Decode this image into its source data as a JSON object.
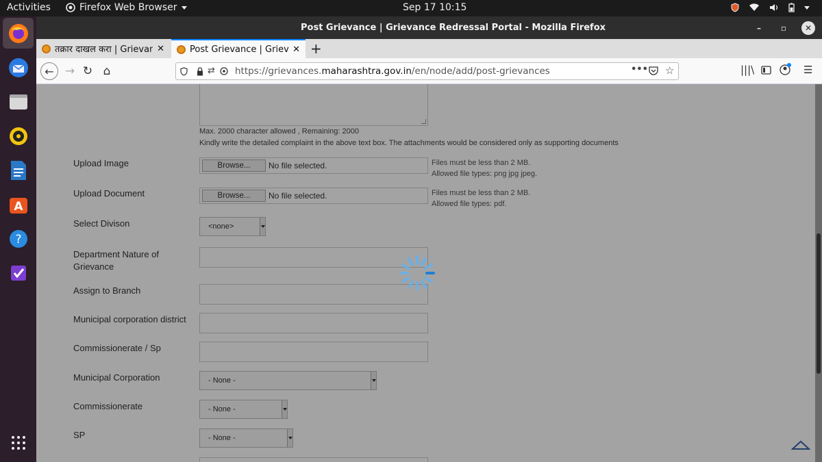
{
  "topbar": {
    "activities": "Activities",
    "app_name": "Firefox Web Browser",
    "clock": "Sep 17  10:15"
  },
  "dock": {
    "items": [
      "firefox-icon",
      "thunderbird-icon",
      "files-icon",
      "rhythmbox-icon",
      "writer-icon",
      "software-icon",
      "help-icon",
      "tasks-icon",
      "show-apps-icon"
    ]
  },
  "window": {
    "title": "Post Grievance | Grievance Redressal Portal - Mozilla Firefox"
  },
  "tabs": [
    {
      "label": "तक्रार दाखल करा | Grievance"
    },
    {
      "label": "Post Grievance | Grievance"
    }
  ],
  "url": {
    "prefix": "https://grievances.",
    "domain": "maharashtra.gov.in",
    "path": "/en/node/add/post-grievances"
  },
  "form": {
    "remaining_note": "Max. 2000 character allowed , Remaining: 2000",
    "detail_note": "Kindly write the detailed complaint in the above text box. The attachments would be considered only as supporting documents",
    "upload_image": {
      "label": "Upload Image",
      "browse": "Browse...",
      "status": "No file selected.",
      "help1": "Files must be less than 2 MB.",
      "help2": "Allowed file types: png jpg jpeg."
    },
    "upload_document": {
      "label": "Upload Document",
      "browse": "Browse...",
      "status": "No file selected.",
      "help1": "Files must be less than 2 MB.",
      "help2": "Allowed file types: pdf."
    },
    "division": {
      "label": "Select Divison",
      "value": "<none>"
    },
    "dept_nature": {
      "label_line1": "Department Nature of",
      "label_line2": "Grievance"
    },
    "branch": {
      "label": "Assign to Branch"
    },
    "mc_district": {
      "label": "Municipal corporation district"
    },
    "commissionerate_sp": {
      "label": "Commissionerate / Sp"
    },
    "municipal_corp": {
      "label": "Municipal Corporation",
      "value": "- None -"
    },
    "commissionerate": {
      "label": "Commissionerate",
      "value": "- None -"
    },
    "sp": {
      "label": "SP",
      "value": "- None -"
    }
  },
  "colors": {
    "accent": "#0a84ff",
    "spinner": "#6ab0e6"
  }
}
